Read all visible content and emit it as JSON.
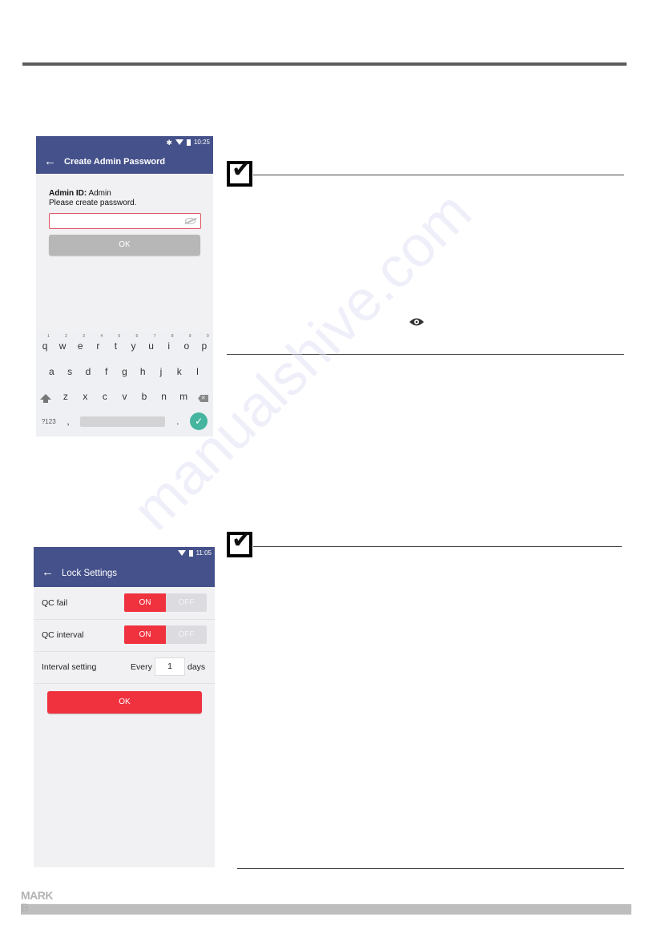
{
  "screen1": {
    "status": {
      "time": "10:25",
      "icons": [
        "bluetooth-icon",
        "wifi-icon",
        "battery-icon"
      ]
    },
    "title": "Create Admin Password",
    "admin_id_label": "Admin ID:",
    "admin_id_value": "Admin",
    "prompt": "Please create password.",
    "password_value": "",
    "ok_label": "OK",
    "keyboard": {
      "row1": [
        "q",
        "w",
        "e",
        "r",
        "t",
        "y",
        "u",
        "i",
        "o",
        "p"
      ],
      "row1_hints": [
        "1",
        "2",
        "3",
        "4",
        "5",
        "6",
        "7",
        "8",
        "9",
        "0"
      ],
      "row2": [
        "a",
        "s",
        "d",
        "f",
        "g",
        "h",
        "j",
        "k",
        "l"
      ],
      "row3": [
        "z",
        "x",
        "c",
        "v",
        "b",
        "n",
        "m"
      ],
      "symbols_label": "?123",
      "comma": ",",
      "period": ".",
      "enter_glyph": "✓",
      "delete_glyph": "✕"
    }
  },
  "screen2": {
    "status": {
      "time": "11:05",
      "icons": [
        "wifi-icon",
        "battery-icon"
      ]
    },
    "title": "Lock Settings",
    "rows": [
      {
        "label": "QC fail",
        "on": "ON",
        "off": "OFF",
        "state": "on"
      },
      {
        "label": "QC interval",
        "on": "ON",
        "off": "OFF",
        "state": "on"
      }
    ],
    "interval": {
      "label": "Interval setting",
      "prefix": "Every",
      "value": "1",
      "suffix": "days"
    },
    "ok_label": "OK"
  },
  "footer": {
    "brand_line1": "MARK",
    "brand_line2": "B"
  },
  "watermark": "manualshive.com",
  "colors": {
    "appbar": "#45518a",
    "accent_red": "#f0323f",
    "enter_green": "#45b5a0"
  }
}
